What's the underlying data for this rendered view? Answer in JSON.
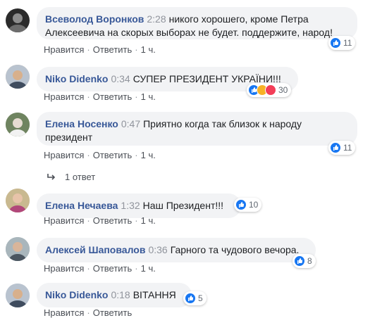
{
  "actions": {
    "like": "Нравится",
    "reply": "Ответить",
    "sep": "·"
  },
  "comments": [
    {
      "author": "Всеволод Воронков",
      "time": "2:28",
      "text": "никого хорошего, кроме Петра Алексеевича на скорых выборах не будет. поддержите, народ!",
      "age": "1 ч.",
      "reaction_count": "11"
    },
    {
      "author": "Niko Didenko",
      "time": "0:34",
      "text": "СУПЕР ПРЕЗИДЕНТ УКРАЇНИ!!!",
      "age": "1 ч.",
      "reaction_count": "30"
    },
    {
      "author": "Елена Носенко",
      "time": "0:47",
      "text": "Приятно когда так близок к народу президент",
      "age": "1 ч.",
      "reaction_count": "11",
      "replies": "1 ответ"
    },
    {
      "author": "Елена Нечаева",
      "time": "1:32",
      "text": "Наш Президент!!!",
      "age": "1 ч.",
      "reaction_count": "10"
    },
    {
      "author": "Алексей Шаповалов",
      "time": "0:36",
      "text": "Гарного та чудового вечора.",
      "age": "1 ч.",
      "reaction_count": "8"
    },
    {
      "author": "Niko Didenko",
      "time": "0:18",
      "text": "ВІТАННЯ",
      "reaction_count": "5"
    }
  ],
  "colors": {
    "author": "#385898",
    "bubble": "#f2f3f5",
    "like_blue": "#1877f2"
  },
  "icons": [
    "like-icon",
    "haha-icon",
    "love-icon",
    "reply-arrow-icon"
  ]
}
